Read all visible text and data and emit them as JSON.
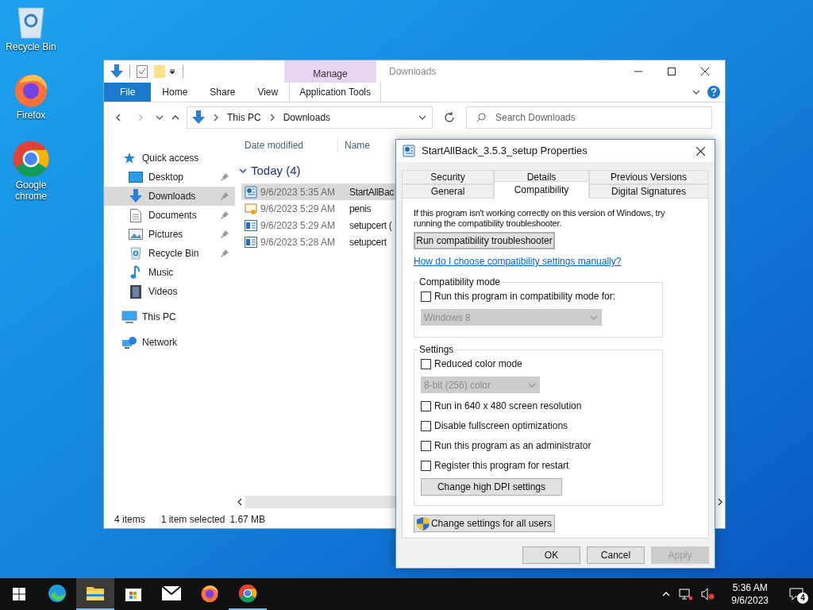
{
  "desktop_icons": [
    {
      "label": "Recycle Bin",
      "kind": "recycle"
    },
    {
      "label": "Firefox",
      "kind": "firefox"
    },
    {
      "label": "Google chrome",
      "kind": "chrome"
    }
  ],
  "explorer": {
    "title": "Downloads",
    "context_header": "Manage",
    "tabs": [
      {
        "label": "File",
        "kind": "file",
        "selected": false
      },
      {
        "label": "Home",
        "kind": "normal",
        "selected": false
      },
      {
        "label": "Share",
        "kind": "normal",
        "selected": false
      },
      {
        "label": "View",
        "kind": "normal",
        "selected": false
      },
      {
        "label": "Application Tools",
        "kind": "context",
        "selected": false
      }
    ],
    "address": [
      "This PC",
      "Downloads"
    ],
    "search_placeholder": "Search Downloads",
    "nav": [
      {
        "label": "Quick access",
        "kind": "star",
        "pinned": false,
        "selected": false,
        "children": [
          {
            "label": "Desktop",
            "kind": "desktop",
            "pinned": true,
            "selected": false
          },
          {
            "label": "Downloads",
            "kind": "download",
            "pinned": true,
            "selected": true
          },
          {
            "label": "Documents",
            "kind": "document",
            "pinned": true,
            "selected": false
          },
          {
            "label": "Pictures",
            "kind": "pictures",
            "pinned": true,
            "selected": false
          },
          {
            "label": "Recycle Bin",
            "kind": "recycle",
            "pinned": true,
            "selected": false
          },
          {
            "label": "Music",
            "kind": "music",
            "pinned": false,
            "selected": false
          },
          {
            "label": "Videos",
            "kind": "videos",
            "pinned": false,
            "selected": false
          }
        ]
      },
      {
        "label": "This PC",
        "kind": "pc",
        "pinned": false,
        "selected": false
      },
      {
        "label": "Network",
        "kind": "network",
        "pinned": false,
        "selected": false
      }
    ],
    "columns": [
      "Date modified",
      "Name"
    ],
    "group": "Today (4)",
    "files": [
      {
        "date": "9/6/2023 5:35 AM",
        "name": "StartAllBac",
        "kind": "setup",
        "selected": true
      },
      {
        "date": "9/6/2023 5:29 AM",
        "name": "penis",
        "kind": "certificate",
        "selected": false
      },
      {
        "date": "9/6/2023 5:29 AM",
        "name": "setupcert (",
        "kind": "app",
        "selected": false
      },
      {
        "date": "9/6/2023 5:28 AM",
        "name": "setupcert",
        "kind": "app",
        "selected": false
      }
    ],
    "status": [
      "4 items",
      "1 item selected",
      "1.67 MB"
    ]
  },
  "dialog": {
    "title": "StartAllBack_3.5.3_setup Properties",
    "tab_rows": [
      [
        {
          "label": "Security",
          "selected": false
        },
        {
          "label": "Details",
          "selected": false
        },
        {
          "label": "Previous Versions",
          "selected": false
        }
      ],
      [
        {
          "label": "General",
          "selected": false
        },
        {
          "label": "Compatibility",
          "selected": true
        },
        {
          "label": "Digital Signatures",
          "selected": false
        }
      ]
    ],
    "intro": "If this program isn't working correctly on this version of Windows, try running the compatibility troubleshooter.",
    "troubleshooter_button": "Run compatibility troubleshooter",
    "help_link": "How do I choose compatibility settings manually?",
    "groups": [
      {
        "legend": "Compatibility mode",
        "items": [
          {
            "kind": "checkbox",
            "label": "Run this program in compatibility mode for:",
            "checked": false
          },
          {
            "kind": "dropdown",
            "value": "Windows 8",
            "disabled": true,
            "wide": true
          }
        ]
      },
      {
        "legend": "Settings",
        "items": [
          {
            "kind": "checkbox",
            "label": "Reduced color mode",
            "checked": false
          },
          {
            "kind": "dropdown",
            "value": "8-bit (256) color",
            "disabled": true,
            "wide": false
          },
          {
            "kind": "checkbox",
            "label": "Run in 640 x 480 screen resolution",
            "checked": false
          },
          {
            "kind": "checkbox",
            "label": "Disable fullscreen optimizations",
            "checked": false
          },
          {
            "kind": "checkbox",
            "label": "Run this program as an administrator",
            "checked": false
          },
          {
            "kind": "checkbox",
            "label": "Register this program for restart",
            "checked": false
          },
          {
            "kind": "button",
            "label": "Change high DPI settings"
          }
        ]
      }
    ],
    "all_users_button": "Change settings for all users",
    "buttons": [
      {
        "label": "OK",
        "disabled": false
      },
      {
        "label": "Cancel",
        "disabled": false
      },
      {
        "label": "Apply",
        "disabled": true
      }
    ]
  },
  "taskbar": {
    "apps": [
      {
        "kind": "edge",
        "running": false,
        "active": false
      },
      {
        "kind": "folder",
        "running": true,
        "active": true
      },
      {
        "kind": "store",
        "running": false,
        "active": false
      },
      {
        "kind": "mail",
        "running": false,
        "active": false
      },
      {
        "kind": "firefox",
        "running": false,
        "active": false
      },
      {
        "kind": "chrome",
        "running": true,
        "active": false
      }
    ],
    "time": "5:36 AM",
    "date": "9/6/2023",
    "notifications": "4"
  }
}
